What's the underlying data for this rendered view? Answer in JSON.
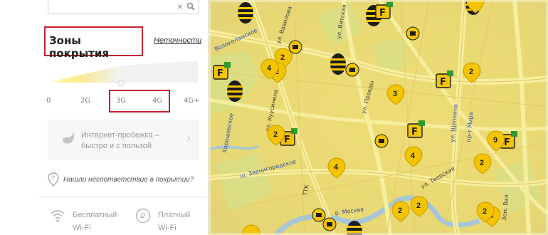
{
  "panel": {
    "search": {
      "placeholder": "",
      "clear_glyph": "×"
    },
    "coverage_title": "Зоны покрытия",
    "inaccuracy_link": "Неточности",
    "scale_ticks": [
      "0",
      "2G",
      "3G",
      "4G",
      "4G+"
    ],
    "promo": {
      "line1": "Интернет-пробежка –",
      "line2": "быстро и с пользой"
    },
    "mismatch_link": "Нашли несоответствие в покрытии?",
    "free_wifi": {
      "line1": "Бесплатный",
      "line2": "Wi-Fi"
    },
    "paid_wifi": {
      "line1": "Платный",
      "line2": "Wi-Fi"
    }
  },
  "map": {
    "street_labels": [
      "ул. Вавилова",
      "ул. Вятская",
      "Волоколамское",
      "ул. Правды",
      "ул. Куусинена",
      "ш. Звенигородское",
      "ул. Тверская",
      "пр-т Мира",
      "ул. Щепкина",
      "ТТК",
      "р. Москва",
      "Хорошевское",
      "Зем. Вал"
    ],
    "count_pins": [
      "2",
      "2",
      "4",
      "2",
      "3",
      "2",
      "4",
      "4",
      "2",
      "9",
      "2",
      "2",
      "6",
      "2"
    ],
    "colors": {
      "pin": "#f5c400",
      "pin_dark": "#d9a900",
      "map_bg": "#e9d877",
      "road": "#f7ee9c",
      "panel_red": "#c8202e"
    }
  }
}
